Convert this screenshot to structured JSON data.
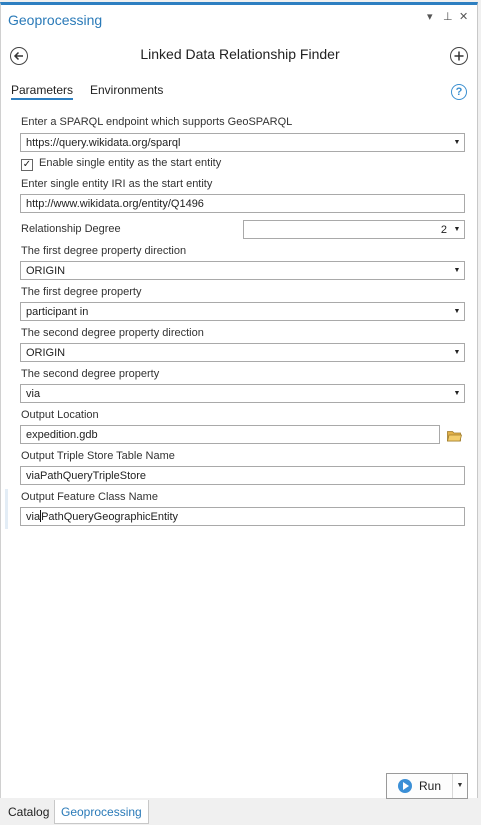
{
  "pane": {
    "title": "Geoprocessing",
    "controls": {
      "dropdown": "▾",
      "pin": "⊥",
      "close": "✕"
    }
  },
  "tool": {
    "title": "Linked Data Relationship Finder",
    "back_icon": "back-arrow-icon",
    "add_icon": "plus-icon"
  },
  "tabs": [
    {
      "label": "Parameters",
      "active": true
    },
    {
      "label": "Environments",
      "active": false
    }
  ],
  "help_label": "?",
  "params": {
    "endpoint": {
      "label": "Enter a SPARQL endpoint which supports GeoSPARQL",
      "value": "https://query.wikidata.org/sparql"
    },
    "single_entity": {
      "label": "Enable single entity as the start entity",
      "checked": true
    },
    "start_iri": {
      "label": "Enter single entity IRI as the start entity",
      "value": "http://www.wikidata.org/entity/Q1496"
    },
    "degree": {
      "label": "Relationship Degree",
      "value": "2"
    },
    "first_dir": {
      "label": "The first degree property direction",
      "value": "ORIGIN"
    },
    "first_prop": {
      "label": "The first degree property",
      "value": "participant in"
    },
    "second_dir": {
      "label": "The second degree property direction",
      "value": "ORIGIN"
    },
    "second_prop": {
      "label": "The second degree property",
      "value": "via"
    },
    "out_location": {
      "label": "Output Location",
      "value": "expedition.gdb"
    },
    "triple_store": {
      "label": "Output Triple Store Table Name",
      "value": "viaPathQueryTripleStore"
    },
    "feature_class": {
      "label": "Output Feature Class Name",
      "value_before_caret": "via",
      "value_after_caret": "PathQueryGeographicEntity"
    }
  },
  "run": {
    "label": "Run"
  },
  "bottom_tabs": [
    {
      "label": "Catalog",
      "active": false
    },
    {
      "label": "Geoprocessing",
      "active": true
    }
  ],
  "colors": {
    "accent": "#2d7fc1",
    "title_text": "#2a7ab8"
  }
}
